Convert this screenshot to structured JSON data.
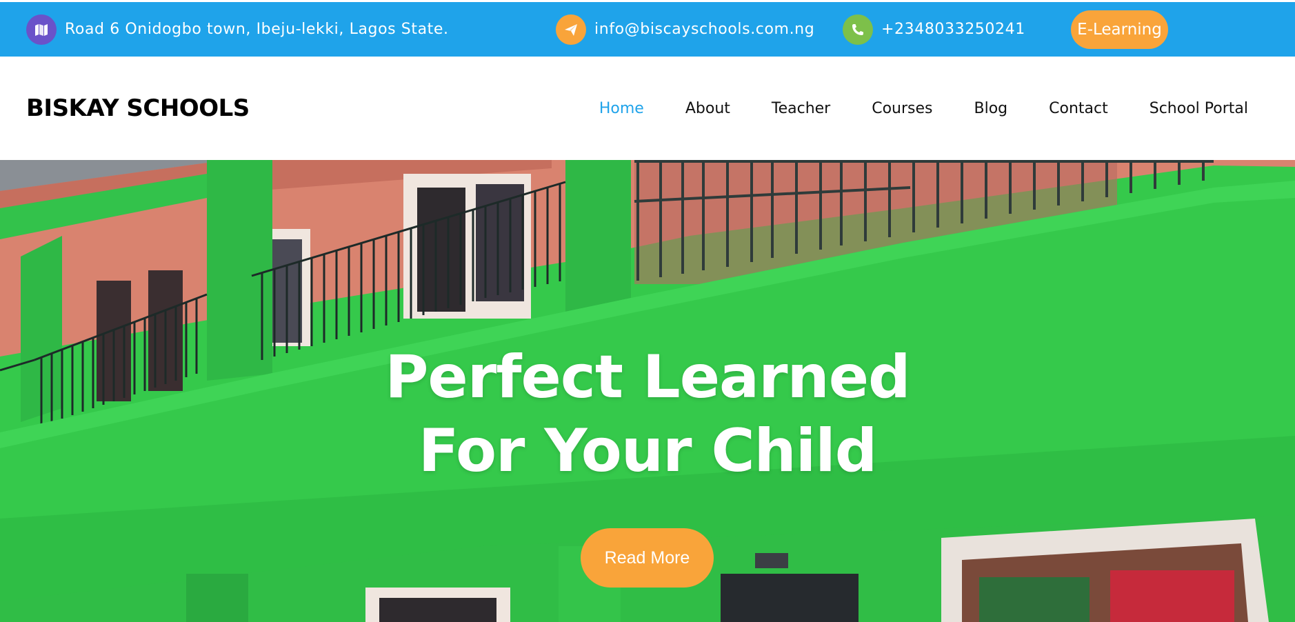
{
  "topbar": {
    "address": {
      "icon": "map-icon",
      "text": "Road 6 Onidogbo town, Ibeju-lekki, Lagos State."
    },
    "email": {
      "icon": "paper-plane-icon",
      "text": "info@biscayschools.com.ng"
    },
    "phone": {
      "icon": "phone-icon",
      "text": "+2348033250241"
    },
    "elearning_label": "E-Learning",
    "colors": {
      "bar": "#1fa3ea",
      "map_icon_bg": "#6a52c9",
      "email_icon_bg": "#f9a43a",
      "phone_icon_bg": "#7dc04a"
    }
  },
  "header": {
    "brand": "BISKAY SCHOOLS",
    "nav": [
      {
        "label": "Home",
        "active": true
      },
      {
        "label": "About"
      },
      {
        "label": "Teacher"
      },
      {
        "label": "Courses"
      },
      {
        "label": "Blog"
      },
      {
        "label": "Contact"
      },
      {
        "label": "School Portal"
      }
    ],
    "active_color": "#1fa3ea"
  },
  "hero": {
    "title_line1": "Perfect Learned",
    "title_line2": "For Your Child",
    "button_label": "Read More",
    "button_color": "#f9a43a",
    "image": "green school building with balconies"
  }
}
